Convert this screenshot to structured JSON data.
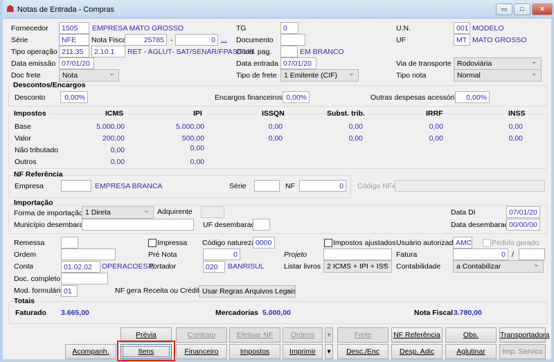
{
  "window": {
    "title": "Notas de Entrada - Compras",
    "minimize": "▭",
    "maximize": "□",
    "close": "✕"
  },
  "header": {
    "fornecedor": {
      "label": "Fornecedor",
      "code": "1505",
      "name": "EMPRESA MATO GROSSO"
    },
    "serie": {
      "label": "Série",
      "value": "NFE"
    },
    "nota_fiscal": {
      "label": "Nota Fiscal",
      "number": "25785",
      "sep": "-",
      "suffix": "0",
      "more": "..."
    },
    "tipo_operacao": {
      "label": "Tipo operação",
      "code": "211.35",
      "cfop": "2.10.1",
      "desc": "RET - AGLUT- SAT/SENAR/FPAS/FUN"
    },
    "data_emissao": {
      "label": "Data emissão",
      "value": "07/01/20"
    },
    "doc_frete": {
      "label": "Doc frete",
      "value": "Nota"
    },
    "tg": {
      "label": "TG",
      "value": "0"
    },
    "documento": {
      "label": "Documento",
      "value": ""
    },
    "cond_pag": {
      "label": "Cond. pag.",
      "value": "",
      "desc": "EM BRANCO"
    },
    "data_entrada": {
      "label": "Data entrada",
      "value": "07/01/20"
    },
    "tipo_frete": {
      "label": "Tipo de frete",
      "value": "1 Emitente (CIF)"
    },
    "un": {
      "label": "U.N.",
      "code": "001",
      "name": "MODELO"
    },
    "uf": {
      "label": "UF",
      "code": "MT",
      "name": "MATO GROSSO"
    },
    "via_transporte": {
      "label": "Via de transporte",
      "value": "Rodoviária"
    },
    "tipo_nota": {
      "label": "Tipo nota",
      "value": "Normal"
    }
  },
  "descontos": {
    "title": "Descontos/Encargos",
    "desconto_label": "Desconto",
    "desconto": "0,00%",
    "encargos_label": "Encargos financeiros",
    "encargos": "0,00%",
    "outras_label": "Outras despesas acessórias",
    "outras": "0,00%"
  },
  "impostos": {
    "title": "Impostos",
    "columns": [
      "ICMS",
      "IPI",
      "ISSQN",
      "Subst. trib.",
      "IRRF",
      "INSS"
    ],
    "rows": [
      {
        "label": "Base",
        "values": [
          "5.000,00",
          "5.000,00",
          "0,00",
          "0,00",
          "0,00",
          "0,00"
        ]
      },
      {
        "label": "Valor",
        "values": [
          "200,00",
          "500,00",
          "0,00",
          "0,00",
          "0,00",
          "0,00"
        ]
      },
      {
        "label": "Não tributado",
        "values": [
          "0,00",
          "0,00"
        ]
      },
      {
        "label": "Outros",
        "values": [
          "0,00",
          "0,00"
        ]
      }
    ]
  },
  "nf_referencia": {
    "title": "NF Referência",
    "empresa_label": "Empresa",
    "empresa": "",
    "empresa_name": "EMPRESA BRANCA",
    "serie_label": "Série",
    "serie": "",
    "nf_label": "NF",
    "nf": "0",
    "codigo_nfe_label": "Código NFe",
    "codigo_nfe": ""
  },
  "importacao": {
    "title": "Importação",
    "forma_label": "Forma de importação",
    "forma": "1 Direta",
    "adquirente_label": "Adquirente",
    "data_di_label": "Data DI",
    "data_di": "07/01/20",
    "municipio_label": "Município desembaraço",
    "municipio": "",
    "uf_label": "UF desembaraço",
    "uf": "",
    "data_desembaraco_label": "Data desembaraço",
    "data_desembaraco": "00/00/00"
  },
  "extra": {
    "remessa_label": "Remessa",
    "remessa": "",
    "impressa_label": "Impressa",
    "codigo_natureza_label": "Código natureza",
    "codigo_natureza": "0000",
    "impostos_ajustados_label": "Impostos ajustados",
    "usuario_label": "Usuário autorizado",
    "usuario": "AMC",
    "pedido_gerado_label": "Pedido gerado",
    "ordem_label": "Ordem",
    "ordem": "",
    "pre_nota_label": "Pré Nota",
    "pre_nota": "0",
    "projeto_label": "Projeto",
    "projeto": "",
    "fatura_label": "Fatura",
    "fatura": "0",
    "fatura_sep": "/",
    "fatura2": "",
    "conta_label": "Conta",
    "conta": "01.02.02",
    "conta_name": "OPERACOES E",
    "portador_label": "Portador",
    "portador": "020",
    "portador_name": "BANRISUL",
    "listar_livros_label": "Listar livros",
    "listar_livros": "2 ICMS + IPI + ISS",
    "contabilidade_label": "Contabilidade",
    "contabilidade": "a Contabilizar",
    "doc_completo_label": "Doc. completo",
    "doc_completo": "",
    "mod_formulario_label": "Mod. formulário",
    "mod_formulario": "01",
    "nf_gera_label": "NF gera Receita ou Crédito",
    "nf_gera": "Usar Regras Arquivos Legais"
  },
  "totais": {
    "title": "Totais",
    "faturado_label": "Faturado",
    "faturado": "3.665,00",
    "mercadorias_label": "Mercadorias",
    "mercadorias": "5.000,00",
    "nota_fiscal_label": "Nota Fiscal",
    "nota_fiscal": "3.780,00"
  },
  "buttons": {
    "previa": "Prévia",
    "contrato": "Contrato",
    "efetivar_nf": "Efetivar NF",
    "ordens": "Ordens",
    "frete": "Frete",
    "nf_referencia": "NF Referência",
    "obs": "Obs.",
    "transportadora": "Transportadora",
    "acompanh": "Acompanh.",
    "itens": "Itens",
    "financeiro": "Financeiro",
    "impostos": "Impostos",
    "imprimir": "Imprimir",
    "desc_enc": "Desc./Enc",
    "desp_adic": "Desp. Adic",
    "aglutinar": "Aglutinar",
    "imp_servico": "Imp. Servico",
    "dropdown_arrow": "▾"
  },
  "colors": {
    "value_text": "#2d2db0",
    "highlight": "#e0201c"
  }
}
